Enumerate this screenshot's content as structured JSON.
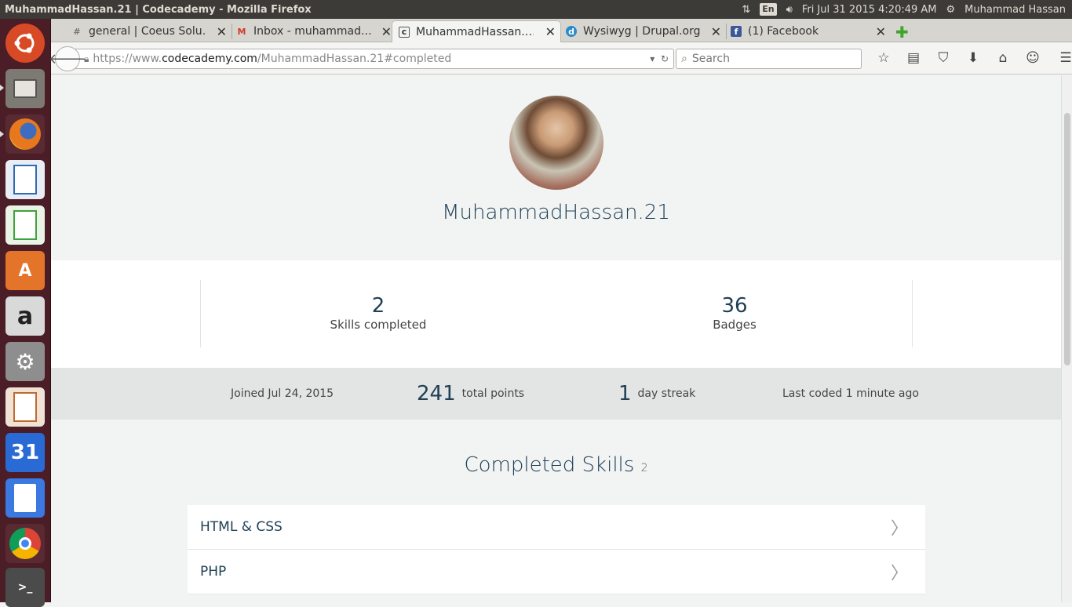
{
  "system": {
    "window_title": "MuhammadHassan.21 | Codecademy - Mozilla Firefox",
    "keyboard_layout": "En",
    "clock": "Fri Jul 31 2015  4:20:49 AM",
    "user": "Muhammad Hassan"
  },
  "launcher": {
    "items": [
      {
        "name": "ubuntu-dash",
        "color": "#d84a26"
      },
      {
        "name": "files",
        "color": "#8a8a85"
      },
      {
        "name": "firefox",
        "color": "#e76d1c"
      },
      {
        "name": "libreoffice-writer",
        "color": "#2d6bb5"
      },
      {
        "name": "libreoffice-calc",
        "color": "#3ea33c"
      },
      {
        "name": "software-center",
        "color": "#e3742a"
      },
      {
        "name": "amazon",
        "color": "#c9c9c9"
      },
      {
        "name": "system-settings",
        "color": "#8e8e8e"
      },
      {
        "name": "libreoffice-impress",
        "color": "#c06a31"
      },
      {
        "name": "calendar",
        "color": "#2a6ad4",
        "label": "31"
      },
      {
        "name": "google-docs",
        "color": "#3b78e0"
      },
      {
        "name": "chrome",
        "color": "#d3b030"
      },
      {
        "name": "terminal",
        "color": "#4b4b4b"
      }
    ]
  },
  "browser": {
    "tabs": [
      {
        "label": "general | Coeus Solu…",
        "active": false,
        "icon": "#"
      },
      {
        "label": "Inbox - muhammad.…",
        "active": false,
        "icon": "M"
      },
      {
        "label": "MuhammadHassan.…",
        "active": true,
        "icon": "c"
      },
      {
        "label": "Wysiwyg | Drupal.org",
        "active": false,
        "icon": "d"
      },
      {
        "label": "(1) Facebook",
        "active": false,
        "icon": "f"
      }
    ],
    "url_prefix": "https://www.",
    "url_domain": "codecademy.com",
    "url_path": "/MuhammadHassan.21#completed",
    "search_placeholder": "Search"
  },
  "profile": {
    "username": "MuhammadHassan.21",
    "stats": [
      {
        "value": "2",
        "label": "Skills completed"
      },
      {
        "value": "36",
        "label": "Badges"
      }
    ],
    "joined": "Joined Jul 24, 2015",
    "points_value": "241",
    "points_label": "total points",
    "streak_value": "1",
    "streak_label": "day streak",
    "last_coded": "Last coded 1 minute ago",
    "completed_title": "Completed Skills",
    "completed_count": "2",
    "skills": [
      {
        "label": "HTML & CSS"
      },
      {
        "label": "PHP"
      }
    ]
  }
}
